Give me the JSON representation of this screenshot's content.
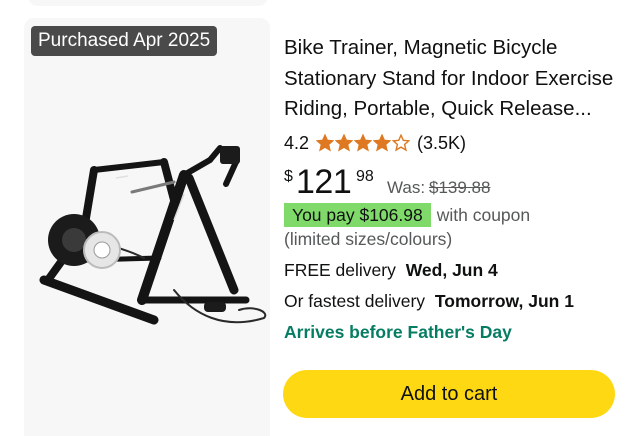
{
  "product": {
    "badge": "Purchased Apr 2025",
    "title": "Bike Trainer, Magnetic Bicycle Stationary Stand for Indoor Exercise Riding, Portable, Quick Release...",
    "image_icon": "bike-trainer-product-photo",
    "rating": {
      "value_text": "4.2",
      "value": 4.2,
      "max": 5,
      "review_count": "(3.5K)",
      "star_color": "#de7921"
    },
    "price": {
      "symbol": "$",
      "whole": "121",
      "fraction": "98",
      "was_label": "Was:",
      "was_price": "$139.88"
    },
    "coupon": {
      "badge_text": "You pay $106.98",
      "suffix": "with coupon",
      "note": "(limited sizes/colours)",
      "badge_color": "#7fda69"
    },
    "delivery": {
      "free_prefix": "FREE delivery",
      "free_date": "Wed, Jun 4",
      "fast_prefix": "Or fastest delivery",
      "fast_date": "Tomorrow, Jun 1",
      "arrives": "Arrives before Father's Day",
      "arrives_color": "#067d62"
    },
    "add_to_cart_label": "Add to cart",
    "add_to_cart_color": "#ffd814"
  }
}
